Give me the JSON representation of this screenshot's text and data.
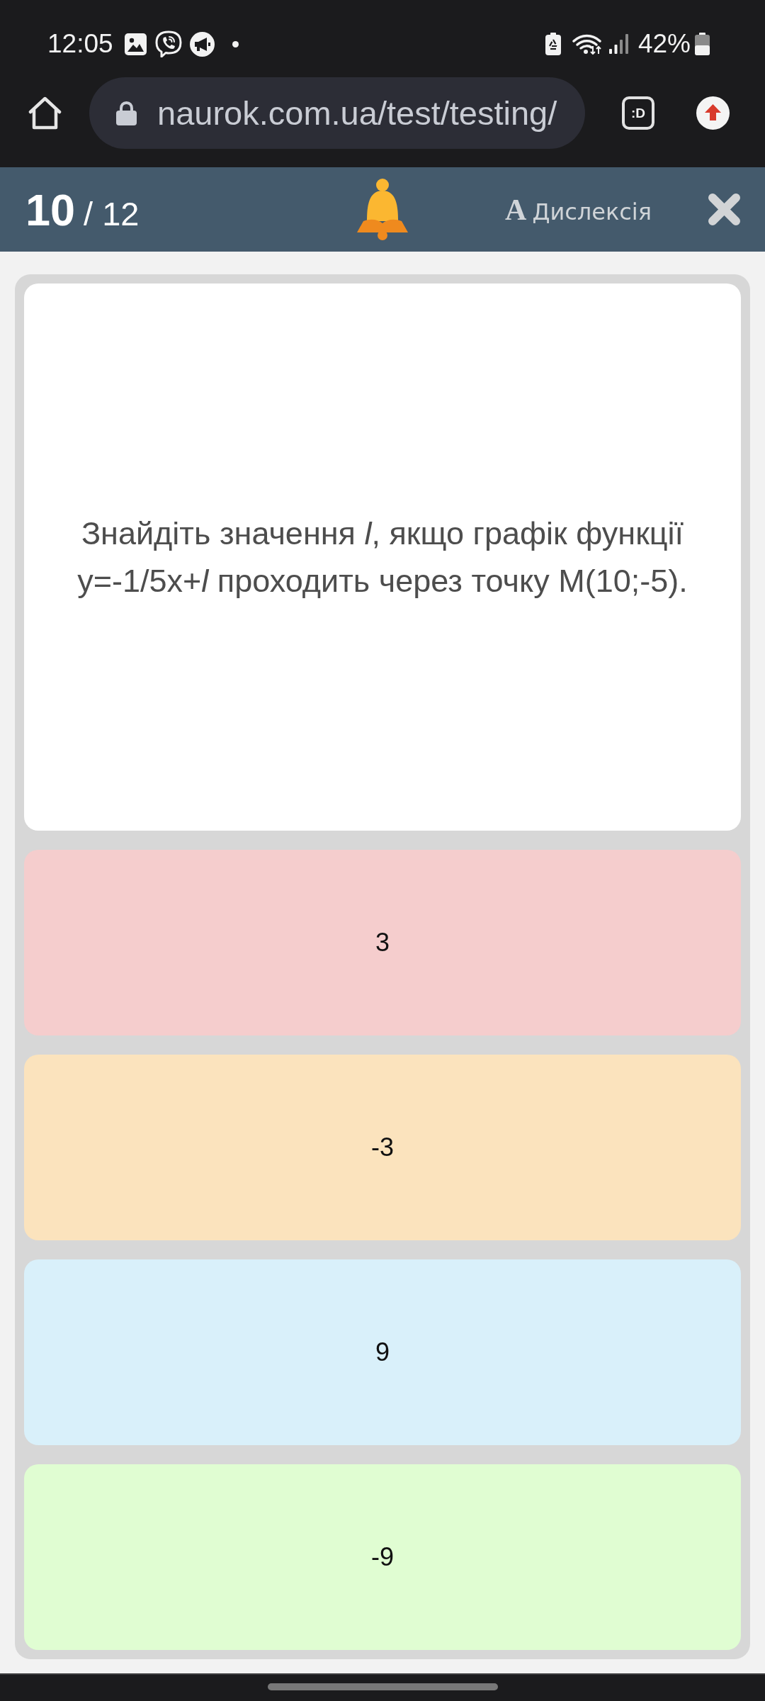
{
  "status_bar": {
    "time": "12:05",
    "battery": "42%"
  },
  "browser": {
    "url": "naurok.com.ua/test/testing/",
    "extension_label": ":D"
  },
  "header": {
    "current": "10",
    "total": "/ 12",
    "dyslexia_letter": "A",
    "dyslexia_label": "Дислексія"
  },
  "question": {
    "text": "Знайдіть значення *l*, якщо графік функції y=-1/5x+*l* проходить через точку M(10;-5)."
  },
  "answers": [
    {
      "text": "3",
      "color": "#f5cdcd"
    },
    {
      "text": "-3",
      "color": "#fbe3bd"
    },
    {
      "text": "9",
      "color": "#d9f0fa"
    },
    {
      "text": "-9",
      "color": "#e0fdd2"
    }
  ]
}
